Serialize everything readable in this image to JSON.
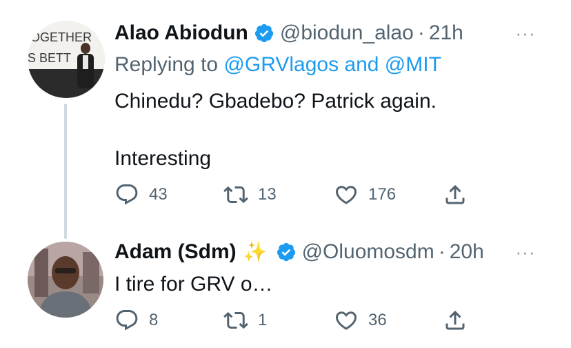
{
  "tweets": [
    {
      "name": "Alao Abiodun",
      "verified": true,
      "handle": "@biodun_alao",
      "separator": "·",
      "time": "21h",
      "reply_prefix": "Replying to ",
      "reply_mentions": "@GRVlagos and @MIT",
      "text_line1": "Chinedu? Gbadebo? Patrick again.",
      "text_line2": "Interesting",
      "more_icon": "···",
      "avatar_sign": {
        "line1": "OGETHER",
        "line2": "S BETT"
      },
      "replies": "43",
      "retweets": "13",
      "likes": "176"
    },
    {
      "name": "Adam (Sdm)",
      "emoji": "✨",
      "verified": true,
      "handle": "@Oluomosdm",
      "separator": "·",
      "time": "20h",
      "text_line1": "I tire for GRV o…",
      "more_icon": "···",
      "replies": "8",
      "retweets": "1",
      "likes": "36"
    }
  ],
  "colors": {
    "accent": "#1d9bf0",
    "secondary_text": "#536471",
    "primary_text": "#0f1419",
    "thread_line": "#cfd9de"
  }
}
